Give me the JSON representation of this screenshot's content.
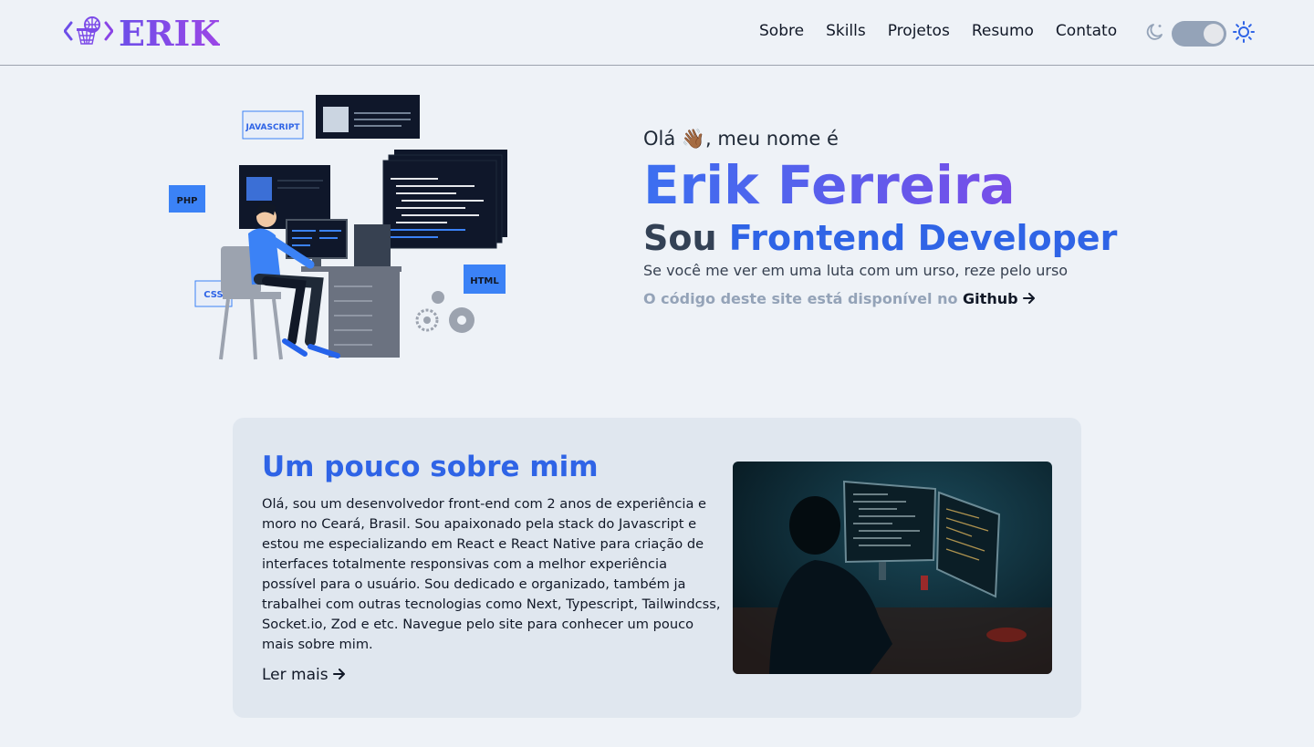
{
  "header": {
    "logo_text": "ERIK",
    "nav": [
      "Sobre",
      "Skills",
      "Projetos",
      "Resumo",
      "Contato"
    ]
  },
  "hero": {
    "greeting": "Olá 👋🏾, meu nome é",
    "name": "Erik Ferreira",
    "role_prefix": "Sou",
    "role": "Frontend Developer",
    "tagline": "Se você me ver em uma luta com um urso, reze pelo urso",
    "source_text": "O código deste site está disponível no",
    "source_link": "Github",
    "illustration_labels": [
      "JAVASCRIPT",
      "PHP",
      "CSS",
      "HTML"
    ]
  },
  "about": {
    "title": "Um pouco sobre mim",
    "body": "Olá, sou um desenvolvedor front-end com 2 anos de experiência e moro no Ceará, Brasil. Sou apaixonado pela stack do Javascript e estou me especializando em React e React Native para criação de interfaces totalmente responsivas com a melhor experiência possível para o usuário. Sou dedicado e organizado, também ja trabalhei com outras tecnologias como Next, Typescript, Tailwindcss, Socket.io, Zod e etc. Navegue pelo site para conhecer um pouco mais sobre mim.",
    "read_more": "Ler mais"
  },
  "colors": {
    "accent_blue": "#2f64e6",
    "accent_purple": "#8a44e6",
    "background": "#eef2f7",
    "card": "#e0e7ef"
  },
  "icons": [
    "basketball-hoop-icon",
    "moon-icon",
    "sun-icon",
    "arrow-right-icon"
  ]
}
